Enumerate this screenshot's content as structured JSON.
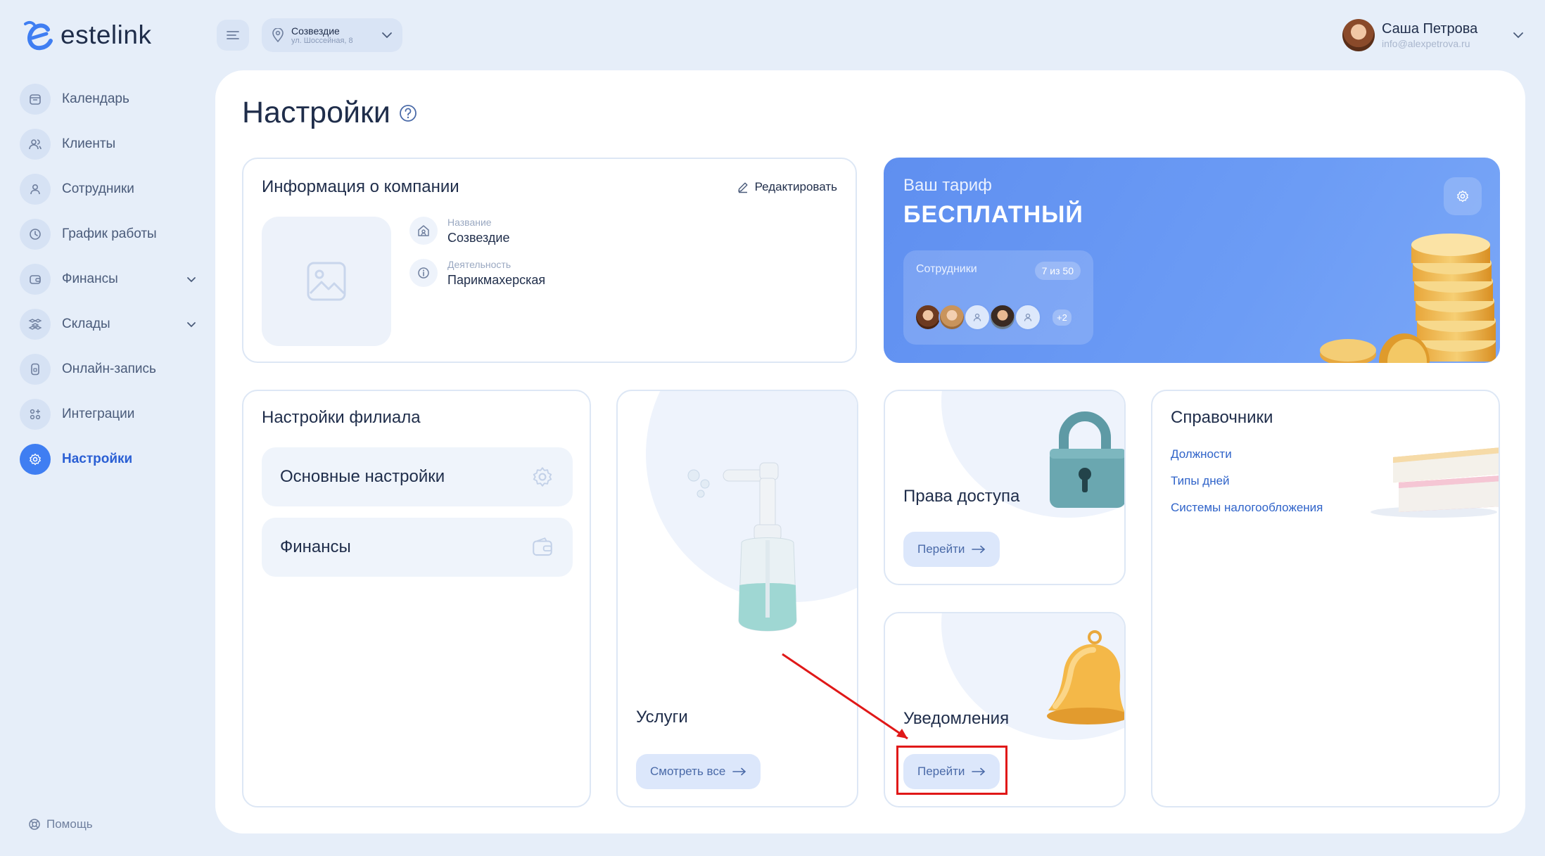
{
  "app": {
    "logo_text": "estelink"
  },
  "header": {
    "branch_name": "Созвездие",
    "branch_address": "ул. Шоссейная, 8",
    "user_name": "Саша Петрова",
    "user_email": "info@alexpetrova.ru"
  },
  "sidebar": {
    "items": [
      {
        "label": "Календарь",
        "icon": "calendar-icon"
      },
      {
        "label": "Клиенты",
        "icon": "clients-icon"
      },
      {
        "label": "Сотрудники",
        "icon": "user-icon"
      },
      {
        "label": "График работы",
        "icon": "clock-icon"
      },
      {
        "label": "Финансы",
        "icon": "wallet-icon",
        "expandable": true
      },
      {
        "label": "Склады",
        "icon": "warehouse-icon",
        "expandable": true
      },
      {
        "label": "Онлайн-запись",
        "icon": "phone-icon"
      },
      {
        "label": "Интеграции",
        "icon": "integrations-icon"
      },
      {
        "label": "Настройки",
        "icon": "settings-icon",
        "active": true
      }
    ],
    "help_label": "Помощь"
  },
  "page": {
    "title": "Настройки"
  },
  "company": {
    "title": "Информация о компании",
    "edit_label": "Редактировать",
    "name_label": "Название",
    "name_value": "Созвездие",
    "activity_label": "Деятельность",
    "activity_value": "Парикмахерская"
  },
  "tariff": {
    "subtitle": "Ваш тариф",
    "name": "БЕСПЛАТНЫЙ",
    "employees_label": "Сотрудники",
    "employees_count": "7 из 50",
    "more_count": "+2"
  },
  "branch_settings": {
    "title": "Настройки филиала",
    "items": [
      {
        "label": "Основные настройки",
        "icon": "gear-icon"
      },
      {
        "label": "Финансы",
        "icon": "wallet-icon"
      }
    ]
  },
  "services": {
    "title": "Услуги",
    "button_label": "Смотреть все"
  },
  "access": {
    "title": "Права доступа",
    "button_label": "Перейти"
  },
  "notifications": {
    "title": "Уведомления",
    "button_label": "Перейти"
  },
  "references": {
    "title": "Справочники",
    "links": [
      "Должности",
      "Типы дней",
      "Системы налогообложения"
    ]
  },
  "colors": {
    "accent": "#3f7ef2",
    "tariff_bg": "#6c9cf5",
    "annotation": "#e01818"
  }
}
